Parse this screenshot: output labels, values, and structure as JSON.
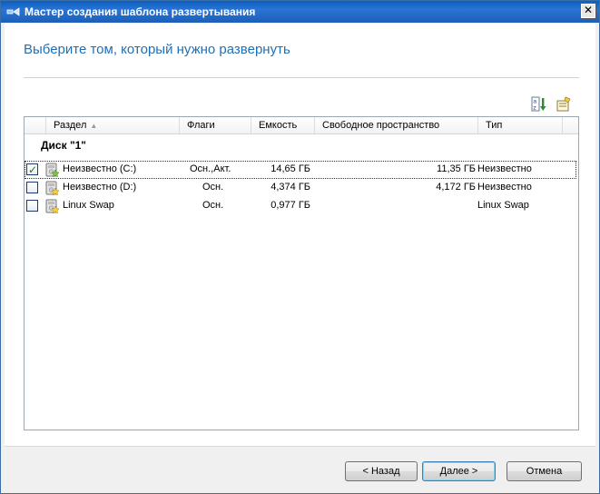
{
  "window": {
    "title": "Мастер создания шаблона развертывания",
    "close_label": "✕"
  },
  "page": {
    "title": "Выберите том, который нужно развернуть"
  },
  "toolbar": {
    "icons": [
      "sort-az-icon",
      "properties-icon"
    ]
  },
  "table": {
    "columns": {
      "partition": "Раздел",
      "flags": "Флаги",
      "capacity": "Емкость",
      "free_space": "Свободное пространство",
      "type": "Тип"
    },
    "sort_indicator": "▲",
    "group": {
      "label": "Диск \"1\""
    },
    "rows": [
      {
        "checked": true,
        "name": "Неизвестно (C:)",
        "flags": "Осн.,Акт.",
        "capacity": "14,65 ГБ",
        "free_space": "11,35 ГБ",
        "type": "Неизвестно"
      },
      {
        "checked": false,
        "name": "Неизвестно (D:)",
        "flags": "Осн.",
        "capacity": "4,374 ГБ",
        "free_space": "4,172 ГБ",
        "type": "Неизвестно"
      },
      {
        "checked": false,
        "name": "Linux Swap",
        "flags": "Осн.",
        "capacity": "0,977 ГБ",
        "free_space": "",
        "type": "Linux Swap"
      }
    ]
  },
  "buttons": {
    "back": "< Назад",
    "next": "Далее >",
    "cancel": "Отмена"
  },
  "colors": {
    "title_accent": "#1f6fb5",
    "titlebar": "#1c5fb8",
    "check": "#1d7d1d"
  }
}
